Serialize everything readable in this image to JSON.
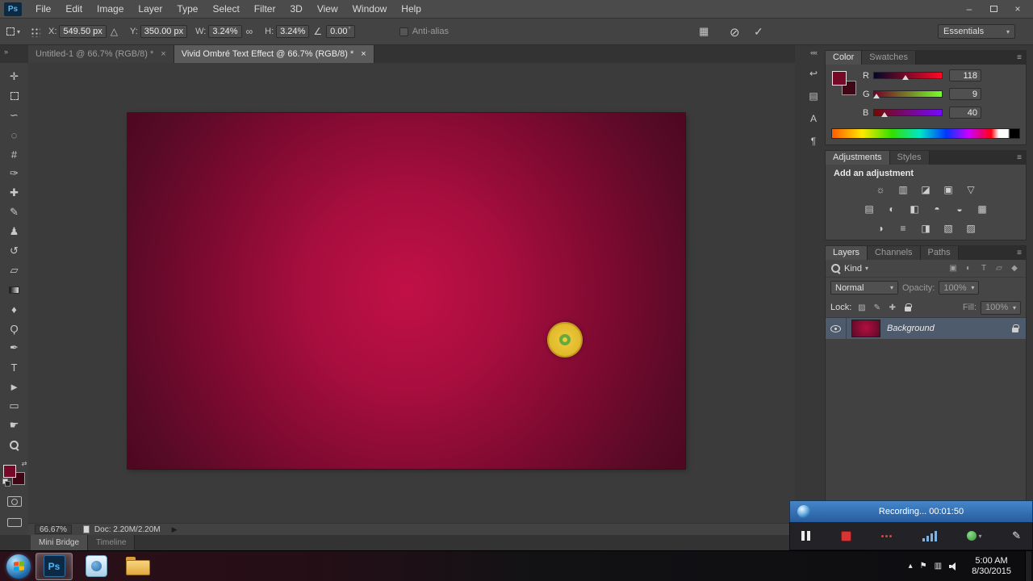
{
  "window": {
    "app_badge": "Ps",
    "menus": [
      {
        "id": "file",
        "label": "File"
      },
      {
        "id": "edit",
        "label": "Edit"
      },
      {
        "id": "image",
        "label": "Image"
      },
      {
        "id": "layer",
        "label": "Layer"
      },
      {
        "id": "type",
        "label": "Type"
      },
      {
        "id": "select",
        "label": "Select"
      },
      {
        "id": "filter",
        "label": "Filter"
      },
      {
        "id": "3d",
        "label": "3D"
      },
      {
        "id": "view",
        "label": "View"
      },
      {
        "id": "window",
        "label": "Window"
      },
      {
        "id": "help",
        "label": "Help"
      }
    ],
    "controls": {
      "minimize": "–",
      "close": "×"
    }
  },
  "options_bar": {
    "x_label": "X:",
    "x_value": "549.50 px",
    "delta_glyph": "△",
    "y_label": "Y:",
    "y_value": "350.00 px",
    "w_label": "W:",
    "w_value": "3.24%",
    "link_glyph": "∞",
    "h_label": "H:",
    "h_value": "3.24%",
    "angle_glyph": "∠",
    "angle_value": "0.00",
    "degree_glyph": "°",
    "anti_alias_label": "Anti-alias",
    "guides_glyph": "▦",
    "cancel_glyph": "⊘",
    "commit_glyph": "✓",
    "workspace_label": "Essentials",
    "caret_glyph": "▾"
  },
  "document_tabs": [
    {
      "label": "Untitled-1 @ 66.7% (RGB/8) *",
      "close": "×",
      "active": false
    },
    {
      "label": "Vivid Ombré Text Effect @ 66.7% (RGB/8) *",
      "close": "×",
      "active": true
    }
  ],
  "toolbar": {
    "collapse_glyph": "»",
    "swap_glyph": "⇄",
    "tools": [
      {
        "name": "move-tool",
        "glyph": "✛"
      },
      {
        "name": "rectangular-marquee-tool",
        "shape": "dashed-box"
      },
      {
        "name": "lasso-tool",
        "glyph": "∽"
      },
      {
        "name": "quick-selection-tool",
        "glyph": "◌"
      },
      {
        "name": "crop-tool",
        "glyph": "#"
      },
      {
        "name": "eyedropper-tool",
        "glyph": "✑"
      },
      {
        "name": "spot-healing-brush-tool",
        "glyph": "✚"
      },
      {
        "name": "brush-tool",
        "glyph": "✎"
      },
      {
        "name": "clone-stamp-tool",
        "glyph": "♟"
      },
      {
        "name": "history-brush-tool",
        "glyph": "↺"
      },
      {
        "name": "eraser-tool",
        "glyph": "▱"
      },
      {
        "name": "gradient-tool",
        "shape": "gradient-box"
      },
      {
        "name": "blur-tool",
        "glyph": "♦"
      },
      {
        "name": "dodge-tool",
        "glyph": "Ϙ"
      },
      {
        "name": "pen-tool",
        "glyph": "✒"
      },
      {
        "name": "type-tool",
        "glyph": "T"
      },
      {
        "name": "path-selection-tool",
        "glyph": "►"
      },
      {
        "name": "rectangle-tool",
        "glyph": "▭"
      },
      {
        "name": "hand-tool",
        "glyph": "☛"
      },
      {
        "name": "zoom-tool",
        "shape": "magnifier"
      }
    ]
  },
  "right_strip": {
    "collapse_glyph": "««",
    "icons": [
      {
        "name": "history-panel",
        "glyph": "↩"
      },
      {
        "name": "properties-panel",
        "glyph": "▤"
      },
      {
        "name": "character-panel",
        "glyph": "A"
      },
      {
        "name": "paragraph-panel",
        "glyph": "¶"
      }
    ]
  },
  "color_panel": {
    "tabs": [
      {
        "label": "Color",
        "active": true
      },
      {
        "label": "Swatches",
        "active": false
      }
    ],
    "menu_glyph": "≡",
    "channels": [
      {
        "label": "R",
        "value": 118,
        "display": "118"
      },
      {
        "label": "G",
        "value": 9,
        "display": "9"
      },
      {
        "label": "B",
        "value": 40,
        "display": "40"
      }
    ]
  },
  "adjustments_panel": {
    "tabs": [
      {
        "label": "Adjustments",
        "active": true
      },
      {
        "label": "Styles",
        "active": false
      }
    ],
    "menu_glyph": "≡",
    "heading": "Add an adjustment",
    "rows": [
      [
        {
          "name": "brightness-contrast",
          "glyph": "☼"
        },
        {
          "name": "levels",
          "glyph": "▥"
        },
        {
          "name": "curves",
          "glyph": "◪"
        },
        {
          "name": "exposure",
          "glyph": "▣"
        },
        {
          "name": "vibrance",
          "glyph": "▽"
        }
      ],
      [
        {
          "name": "hue-saturation",
          "glyph": "▤"
        },
        {
          "name": "color-balance",
          "glyph": "◐"
        },
        {
          "name": "black-and-white",
          "glyph": "◧"
        },
        {
          "name": "photo-filter",
          "glyph": "◓"
        },
        {
          "name": "channel-mixer",
          "glyph": "◒"
        },
        {
          "name": "color-lookup",
          "glyph": "▦"
        }
      ],
      [
        {
          "name": "invert",
          "glyph": "◑"
        },
        {
          "name": "posterize",
          "glyph": "≡"
        },
        {
          "name": "threshold",
          "glyph": "◨"
        },
        {
          "name": "gradient-map",
          "glyph": "▧"
        },
        {
          "name": "selective-color",
          "glyph": "▨"
        }
      ]
    ]
  },
  "layers_panel": {
    "tabs": [
      {
        "label": "Layers",
        "active": true
      },
      {
        "label": "Channels",
        "active": false
      },
      {
        "label": "Paths",
        "active": false
      }
    ],
    "menu_glyph": "≡",
    "filter_label": "Kind",
    "filter_icons": [
      {
        "name": "filter-pixel-layers",
        "glyph": "▣"
      },
      {
        "name": "filter-adjustment-layers",
        "glyph": "◐"
      },
      {
        "name": "filter-type-layers",
        "glyph": "T"
      },
      {
        "name": "filter-shape-layers",
        "glyph": "▱"
      },
      {
        "name": "filter-smart-objects",
        "glyph": "◆"
      }
    ],
    "blend_mode": "Normal",
    "opacity_label": "Opacity:",
    "opacity_value": "100%",
    "lock_label": "Lock:",
    "lock_icons": [
      {
        "name": "lock-transparent-pixels",
        "glyph": "▨"
      },
      {
        "name": "lock-image-pixels",
        "glyph": "✎"
      },
      {
        "name": "lock-position",
        "glyph": "✚"
      },
      {
        "name": "lock-all",
        "shape": "lock"
      }
    ],
    "fill_label": "Fill:",
    "fill_value": "100%",
    "layer": {
      "name": "Background"
    },
    "caret_glyph": "▾"
  },
  "status_bar": {
    "zoom": "66.67%",
    "doc": "Doc: 2.20M/2.20M",
    "flyout_glyph": "▶"
  },
  "bottom_bar": {
    "tabs": [
      {
        "label": "Mini Bridge",
        "active": true
      },
      {
        "label": "Timeline",
        "active": false
      }
    ]
  },
  "recording": {
    "status": "Recording...",
    "elapsed": "00:01:50",
    "pencil_glyph": "✎",
    "caret_glyph": "▾"
  },
  "taskbar": {
    "chevron_glyph": "▴",
    "tray_icons": [
      {
        "name": "action-center-flag",
        "glyph": "⚑"
      },
      {
        "name": "network",
        "glyph": "▥"
      },
      {
        "name": "volume",
        "shape": "speaker"
      }
    ],
    "time": "5:00 AM",
    "date": "8/30/2015"
  },
  "colors": {
    "canvas_center": "#c11047",
    "canvas_edge": "#4e0820",
    "foreground_swatch": "#760928",
    "background_swatch": "#3d0715",
    "selected_layer_row": "#4d5b6c",
    "layer_thumbnail": "#9c0f3a",
    "recording_bar_top": "#4486c9",
    "recording_bar_bottom": "#285d9f",
    "click_circle": "#e8c535",
    "click_ring": "#66a93c",
    "accent_blue": "#53b6f5"
  }
}
